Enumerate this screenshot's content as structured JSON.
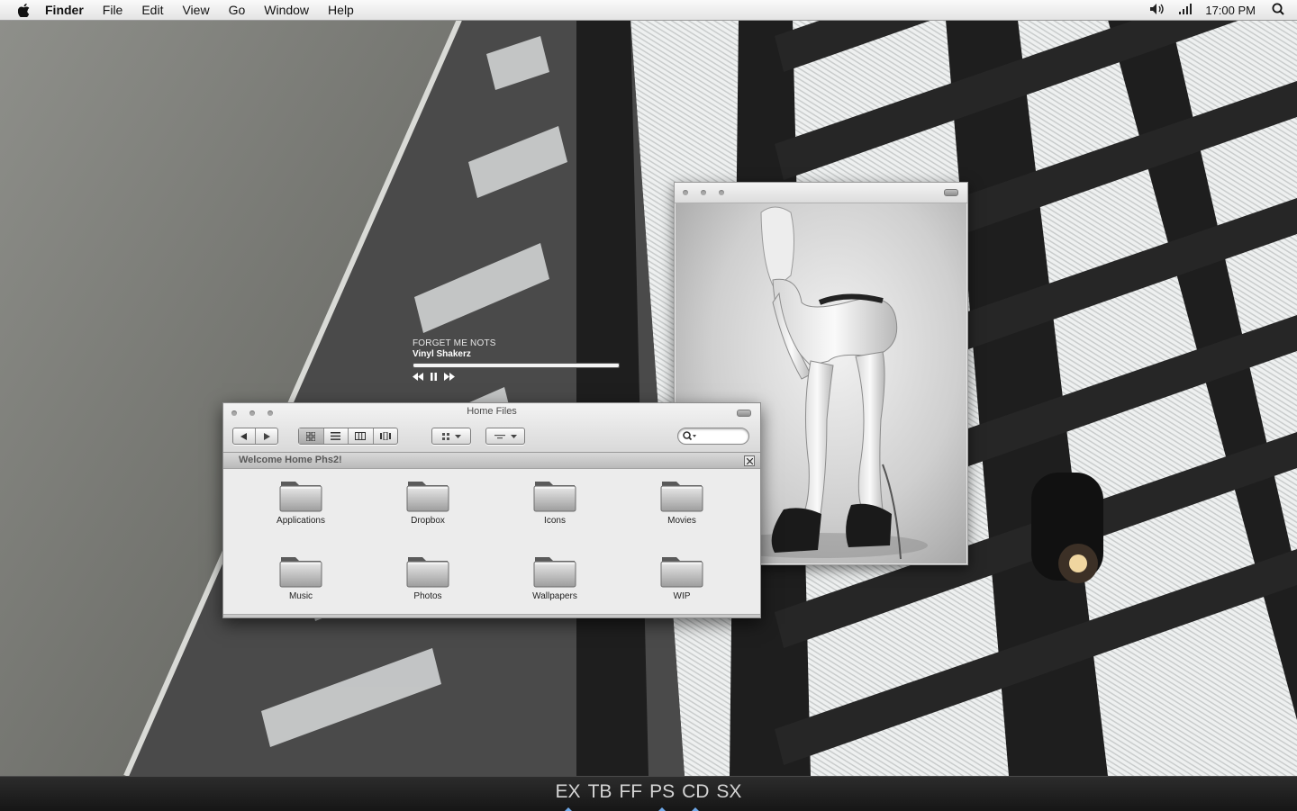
{
  "menubar": {
    "app_name": "Finder",
    "menus": [
      "File",
      "Edit",
      "View",
      "Go",
      "Window",
      "Help"
    ],
    "clock": "17:00 PM"
  },
  "music_widget": {
    "track": "FORGET ME NOTS",
    "artist": "Vinyl Shakerz",
    "progress": 1.0
  },
  "finder": {
    "title": "Home Files",
    "banner": "Welcome Home Phs2!",
    "items": [
      {
        "label": "Applications"
      },
      {
        "label": "Dropbox"
      },
      {
        "label": "Icons"
      },
      {
        "label": "Movies"
      },
      {
        "label": "Music"
      },
      {
        "label": "Photos"
      },
      {
        "label": "Wallpapers"
      },
      {
        "label": "WIP"
      }
    ]
  },
  "dock": {
    "items": [
      {
        "label": "EX",
        "running": true
      },
      {
        "label": "TB",
        "running": false
      },
      {
        "label": "FF",
        "running": false
      },
      {
        "label": "PS",
        "running": true
      },
      {
        "label": "CD",
        "running": true
      },
      {
        "label": "SX",
        "running": false
      }
    ]
  },
  "icons": {
    "apple": "apple-logo-icon",
    "volume": "speaker-icon",
    "signal": "signal-bars-icon",
    "spotlight": "spotlight-search-icon",
    "folder": "folder-icon"
  }
}
